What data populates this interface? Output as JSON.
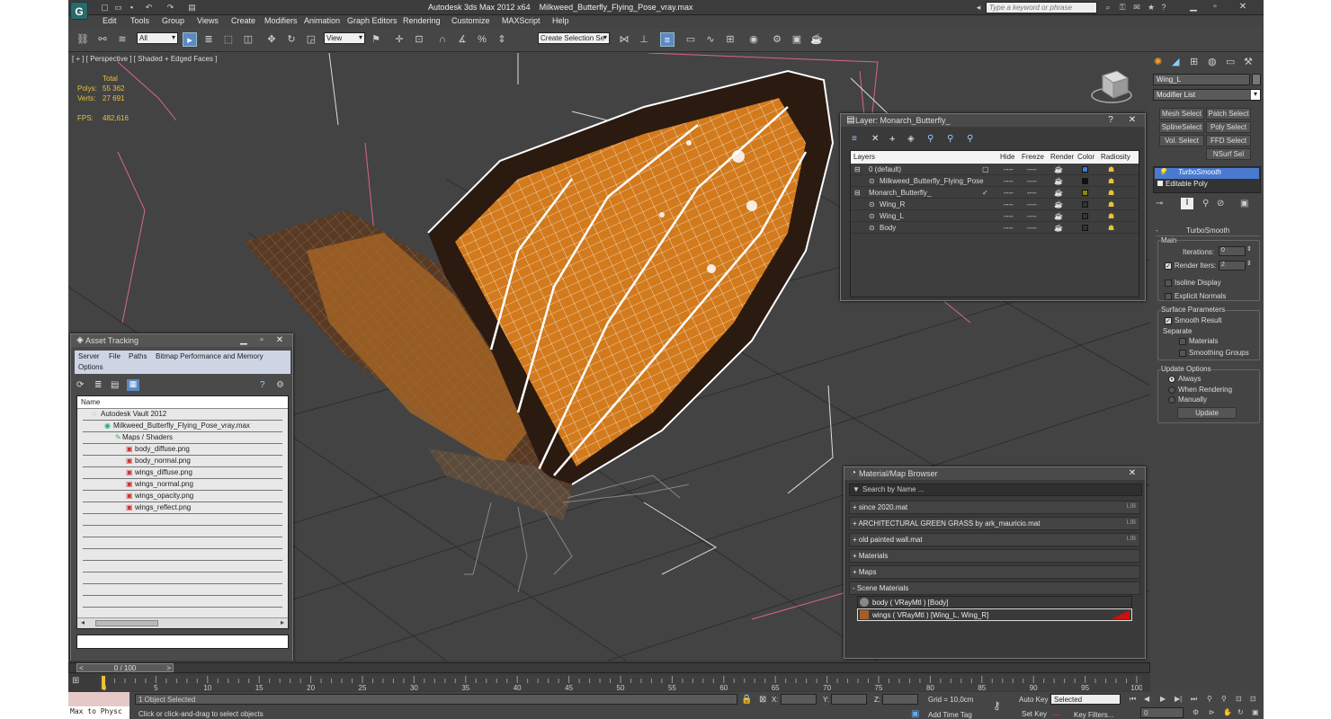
{
  "app": {
    "title": "Autodesk 3ds Max  2012 x64",
    "file": "Milkweed_Butterfly_Flying_Pose_vray.max",
    "search_placeholder": "Type a keyword or phrase",
    "logo": "app-logo"
  },
  "menu": [
    "Edit",
    "Tools",
    "Group",
    "Views",
    "Create",
    "Modifiers",
    "Animation",
    "Graph Editors",
    "Rendering",
    "Customize",
    "MAXScript",
    "Help"
  ],
  "toolbar": {
    "filter": "All",
    "ref_coord": "View",
    "selection_set": "Create Selection Se"
  },
  "viewport": {
    "label": "[ + ] [ Perspective ] [ Shaded + Edged Faces ]",
    "stats": {
      "header": "Total",
      "polys_label": "Polys:",
      "polys": "55 362",
      "verts_label": "Verts:",
      "verts": "27 691",
      "fps_label": "FPS:",
      "fps": "482,616"
    }
  },
  "layer_panel": {
    "title": "Layer: Monarch_Butterfly_",
    "headers": [
      "Layers",
      "Hide",
      "Freeze",
      "Render",
      "Color",
      "Radiosity"
    ],
    "rows": [
      {
        "name": "0 (default)",
        "color": "#3a7ed8"
      },
      {
        "name": "Milkweed_Butterfly_Flying_Pose",
        "color": "#111111"
      },
      {
        "name": "Monarch_Butterfly_",
        "color": "#8a8a10"
      },
      {
        "name": "Wing_R",
        "color": "#333333"
      },
      {
        "name": "Wing_L",
        "color": "#333333"
      },
      {
        "name": "Body",
        "color": "#333333"
      }
    ],
    "dash": "----"
  },
  "asset_panel": {
    "title": "Asset Tracking",
    "menu": [
      "Server",
      "File",
      "Paths",
      "Bitmap Performance and Memory",
      "Options"
    ],
    "column": "Name",
    "items": [
      "Autodesk Vault 2012",
      "Milkweed_Butterfly_Flying_Pose_vray.max",
      "Maps / Shaders",
      "body_diffuse.png",
      "body_normal.png",
      "wings_diffuse.png",
      "wings_normal.png",
      "wings_opacity.png",
      "wings_reflect.png"
    ]
  },
  "material_panel": {
    "title": "Material/Map Browser",
    "search": "Search by Name ...",
    "libs": [
      {
        "name": "+ since 2020.mat",
        "tag": "LIB"
      },
      {
        "name": "+ ARCHITECTURAL GREEN GRASS by ark_mauricio.mat",
        "tag": "LIB"
      },
      {
        "name": "+ old painted wall.mat",
        "tag": "LIB"
      },
      {
        "name": "+ Materials",
        "tag": ""
      },
      {
        "name": "+ Maps",
        "tag": ""
      },
      {
        "name": "- Scene Materials",
        "tag": ""
      }
    ],
    "scene": [
      "body  ( VRayMtl )  [Body]",
      "wings  ( VRayMtl )  [Wing_L, Wing_R]"
    ]
  },
  "command_panel": {
    "object_name": "Wing_L",
    "modifier_list": "Modifier List",
    "buttons": [
      "Mesh Select",
      "Patch Select",
      "SplineSelect",
      "Poly Select",
      "Vol. Select",
      "FFD Select",
      "NSurf Sel"
    ],
    "stack": [
      "TurboSmooth",
      "Editable Poly"
    ],
    "rollout": "TurboSmooth",
    "main": "Main",
    "iterations_label": "Iterations:",
    "iterations": "0",
    "render_iters_label": "Render Iters:",
    "render_iters": "2",
    "isoline": "Isoline Display",
    "explicit": "Explicit Normals",
    "surface": "Surface Parameters",
    "smooth": "Smooth Result",
    "separate": "Separate",
    "materials": "Materials",
    "smoothing": "Smoothing Groups",
    "update_opts": "Update Options",
    "always": "Always",
    "when_rendering": "When Rendering",
    "manually": "Manually",
    "update": "Update"
  },
  "timeline": {
    "frame": "0 / 100",
    "ticks": [
      "0",
      "5",
      "10",
      "15",
      "20",
      "25",
      "30",
      "35",
      "40",
      "45",
      "50",
      "55",
      "60",
      "65",
      "70",
      "75",
      "80",
      "85",
      "90",
      "95",
      "100"
    ]
  },
  "status": {
    "listener": "Max to Physc",
    "selected": "1 Object Selected",
    "prompt": "Click or click-and-drag to select objects",
    "x": "X:",
    "y": "Y:",
    "z": "Z:",
    "grid": "Grid = 10,0cm",
    "autokey": "Auto Key",
    "setkey": "Set Key",
    "selected_dd": "Selected",
    "add_tag": "Add Time Tag",
    "key_filters": "Key Filters...",
    "frame": "0"
  }
}
